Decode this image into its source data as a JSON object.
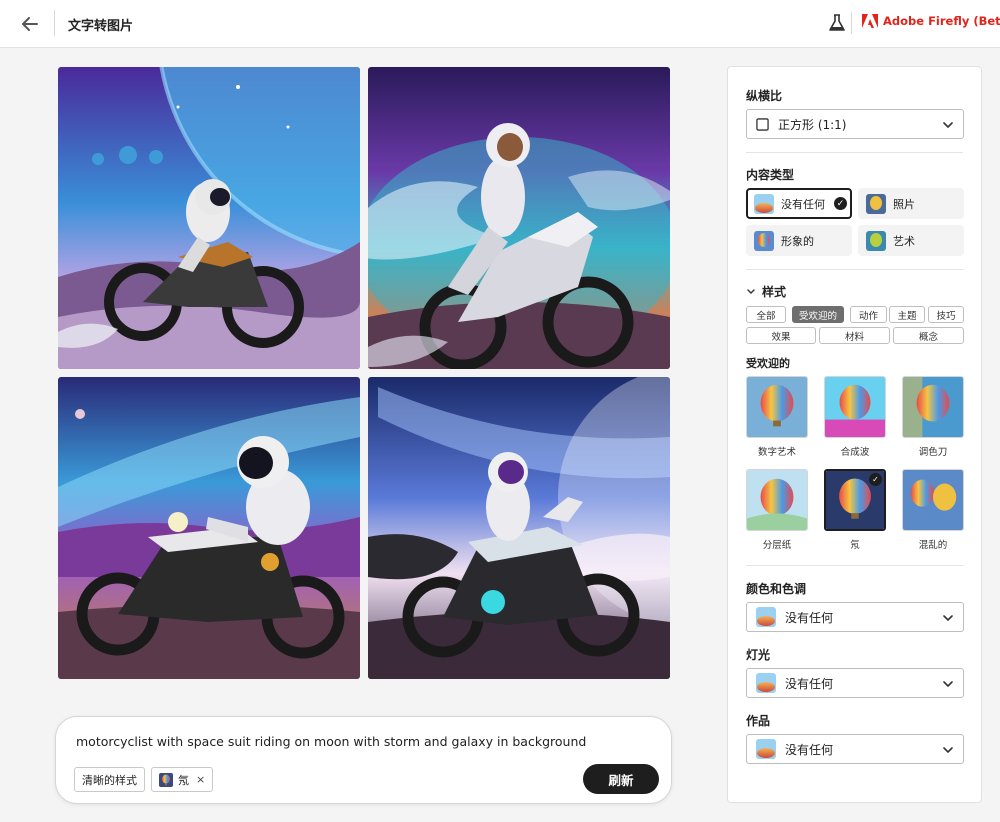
{
  "header": {
    "title": "文字转图片",
    "brand": "Adobe Firefly (Beta)"
  },
  "prompt": {
    "text": "motorcyclist with space suit riding on moon with storm and galaxy in background",
    "chips": [
      "清晰的样式",
      "氖"
    ],
    "refresh_label": "刷新"
  },
  "panel": {
    "aspect": {
      "label": "纵横比",
      "value": "正方形 (1:1)"
    },
    "content_type": {
      "label": "内容类型",
      "options": [
        "没有任何",
        "照片",
        "形象的",
        "艺术"
      ],
      "selected": "没有任何"
    },
    "styles": {
      "label": "样式",
      "tabs_row1": [
        "全部",
        "受欢迎的",
        "动作",
        "主题",
        "技巧"
      ],
      "tabs_row2": [
        "效果",
        "材料",
        "概念"
      ],
      "active_tab": "受欢迎的",
      "section_label": "受欢迎的",
      "thumbs": [
        "数字艺术",
        "合成波",
        "调色刀",
        "分层纸",
        "氖",
        "混乱的"
      ],
      "selected_thumb": "氖"
    },
    "color": {
      "label": "颜色和色调",
      "value": "没有任何"
    },
    "lighting": {
      "label": "灯光",
      "value": "没有任何"
    },
    "composition": {
      "label": "作品",
      "value": "没有任何"
    }
  },
  "icons": [
    "back-arrow-icon",
    "flask-icon",
    "adobe-logo-icon",
    "chevron-down-icon",
    "checkmark-icon",
    "chevron-down-small-icon",
    "close-icon"
  ],
  "colors": {
    "brand": "#e1251b",
    "dark": "#1e1e1e",
    "active_tab": "#6e6e6e"
  }
}
